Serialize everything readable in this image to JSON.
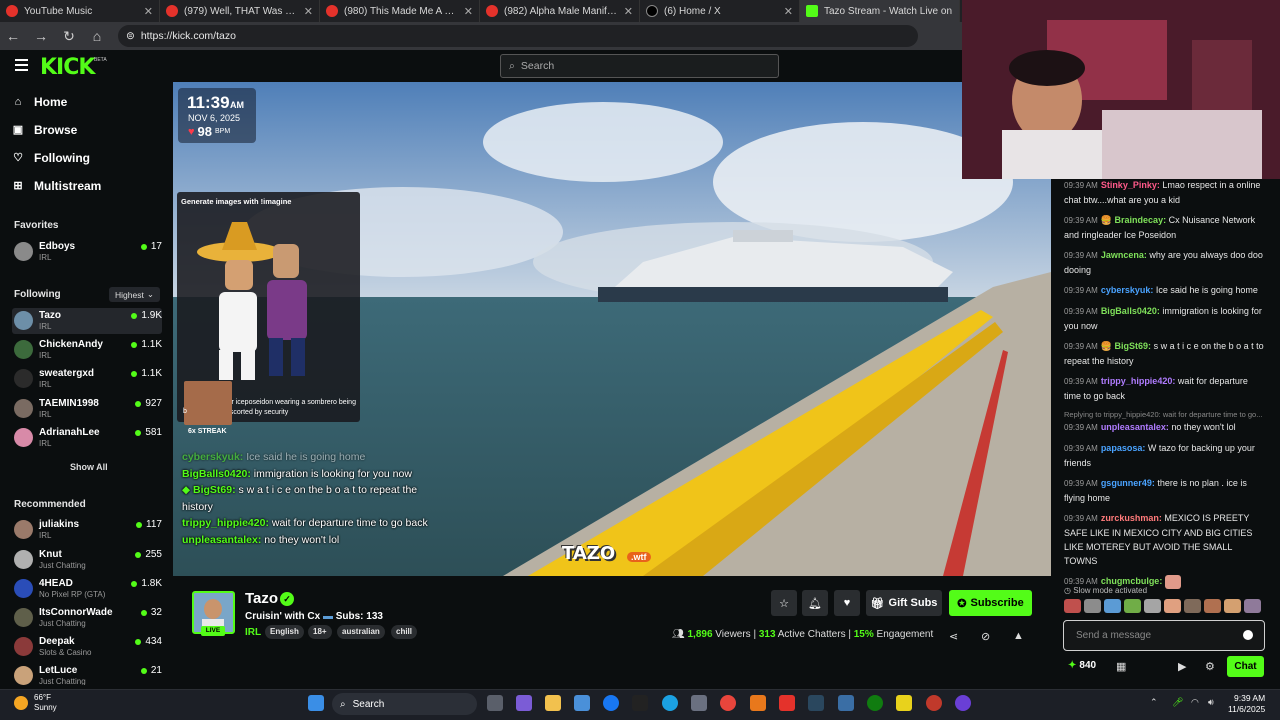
{
  "browser": {
    "tabs": [
      {
        "title": "YouTube Music",
        "icon": "youtube-music-icon"
      },
      {
        "title": "(979) Well, THAT Was Unexpected",
        "icon": "youtube-icon"
      },
      {
        "title": "(980) This Made Me A Believer in",
        "icon": "youtube-icon"
      },
      {
        "title": "(982) Alpha Male Manifest Guru",
        "icon": "youtube-icon"
      },
      {
        "title": "(6) Home / X",
        "icon": "x-icon"
      },
      {
        "title": "Tazo Stream - Watch Live on",
        "icon": "kick-icon"
      }
    ],
    "url": "https://kick.com/tazo"
  },
  "header": {
    "logo": "KICK",
    "logo_badge": "BETA",
    "search_placeholder": "Search"
  },
  "sidebar": {
    "nav": [
      {
        "label": "Home",
        "icon": "home-icon"
      },
      {
        "label": "Browse",
        "icon": "browse-icon"
      },
      {
        "label": "Following",
        "icon": "heart-icon"
      },
      {
        "label": "Multistream",
        "icon": "grid-icon"
      }
    ],
    "favorites_title": "Favorites",
    "favorites": [
      {
        "name": "Edboys",
        "category": "IRL",
        "viewers": "17"
      }
    ],
    "following_title": "Following",
    "sort_label": "Highest",
    "following": [
      {
        "name": "Tazo",
        "category": "IRL",
        "viewers": "1.9K"
      },
      {
        "name": "ChickenAndy",
        "category": "IRL",
        "viewers": "1.1K"
      },
      {
        "name": "sweatergxd",
        "category": "IRL",
        "viewers": "1.1K"
      },
      {
        "name": "TAEMIN1998",
        "category": "IRL",
        "viewers": "927"
      },
      {
        "name": "AdrianahLee",
        "category": "IRL",
        "viewers": "581"
      }
    ],
    "show_all": "Show All",
    "recommended_title": "Recommended",
    "recommended": [
      {
        "name": "juliakins",
        "category": "IRL",
        "viewers": "117"
      },
      {
        "name": "Knut",
        "category": "Just Chatting",
        "viewers": "255"
      },
      {
        "name": "4HEAD",
        "category": "No Pixel RP (GTA)",
        "viewers": "1.8K"
      },
      {
        "name": "ItsConnorWade",
        "category": "Just Chatting",
        "viewers": "32"
      },
      {
        "name": "Deepak",
        "category": "Slots & Casino",
        "viewers": "434"
      },
      {
        "name": "LetLuce",
        "category": "Just Chatting",
        "viewers": "21"
      }
    ]
  },
  "video": {
    "time": "11:39",
    "ampm": "AM",
    "date": "NOV 6, 2025",
    "bpm": "98",
    "bpm_unit": "BPM",
    "imagine_title": "Generate images with !imagine",
    "imagine_caption": "ier iceposeidon wearing a sombrero being escorted by security",
    "imagine_caption_lead": "b",
    "streak": "6x STREAK",
    "overlay_chat": [
      {
        "user": "cyberskyuk:",
        "text": " Ice said he is going home",
        "color": "#53fc18"
      },
      {
        "user": "BigBalls0420:",
        "text": " immigration is looking for you now",
        "color": "#53fc18"
      },
      {
        "user": "BigSt69:",
        "text": " s w a t i c e on the b o a t to repeat the history",
        "color": "#53fc18"
      },
      {
        "user": "trippy_hippie420:",
        "text": " wait for departure time to go back",
        "color": "#53fc18"
      },
      {
        "user": "unpleasantalex:",
        "text": " no they won't lol",
        "color": "#53fc18"
      }
    ],
    "watermark": "TAZO",
    "watermark_suffix": ".wtf"
  },
  "chat": {
    "messages": [
      {
        "time": "09:39 AM",
        "user": "Stinky_Pinky:",
        "text": " Lmao respect in a online chat btw....what are you a kid",
        "color": "#ff5a8a"
      },
      {
        "time": "09:39 AM",
        "user": "Braindecay:",
        "text": " Cx Nuisance Network and ringleader Ice Poseidon",
        "color": "#7fe05a"
      },
      {
        "time": "09:39 AM",
        "user": "Jawncena:",
        "text": " why are you always doo doo dooing",
        "color": "#7fe05a"
      },
      {
        "time": "09:39 AM",
        "user": "cyberskyuk:",
        "text": " Ice said he is going home",
        "color": "#4aa3ff"
      },
      {
        "time": "09:39 AM",
        "user": "BigBalls0420:",
        "text": " immigration is looking for you now",
        "color": "#7fe05a"
      },
      {
        "time": "09:39 AM",
        "user": "BigSt69:",
        "text": " s w a t i c e on the b o a t to repeat the history",
        "color": "#7fe05a"
      },
      {
        "time": "09:39 AM",
        "user": "trippy_hippie420:",
        "text": " wait for departure time to go back",
        "color": "#b07cff"
      },
      {
        "time": "09:39 AM",
        "user": "unpleasantalex:",
        "text": " no they won't lol",
        "color": "#b07cff",
        "reply": "Replying to trippy_hippie420: wait for departure time to go..."
      },
      {
        "time": "09:39 AM",
        "user": "papasosa:",
        "text": " W tazo for backing up your friends",
        "color": "#4aa3ff"
      },
      {
        "time": "09:39 AM",
        "user": "gsgunner49:",
        "text": " there is no plan . ice is flying home",
        "color": "#4aa3ff"
      },
      {
        "time": "09:39 AM",
        "user": "zurckushman:",
        "text": " MEXICO IS PREETY SAFE LIKE IN MEXICO CITY AND BIG CITIES LIKE MOTEREY BUT AVOID THE SMALL TOWNS",
        "color": "#ff7a7a"
      },
      {
        "time": "09:39 AM",
        "user": "chugmcbulge:",
        "text": "",
        "color": "#7fe05a"
      }
    ],
    "slow_mode": "Slow mode activated",
    "input_placeholder": "Send a message",
    "points": "840",
    "chat_button": "Chat"
  },
  "streamer": {
    "name": "Tazo",
    "live_label": "LIVE",
    "title": "Cruisin' with Cx",
    "subs_label": "Subs: 133",
    "category": "IRL",
    "tags": [
      "English",
      "18+",
      "australian",
      "chill"
    ],
    "gift_subs": "Gift Subs",
    "subscribe": "Subscribe",
    "viewers": "1,896",
    "viewers_label": "Viewers",
    "chatters": "313",
    "chatters_label": "Active Chatters",
    "engagement": "15%",
    "engagement_label": "Engagement"
  },
  "taskbar": {
    "temp": "66°F",
    "weather": "Sunny",
    "search": "Search",
    "time": "9:39 AM",
    "date": "11/6/2025"
  }
}
